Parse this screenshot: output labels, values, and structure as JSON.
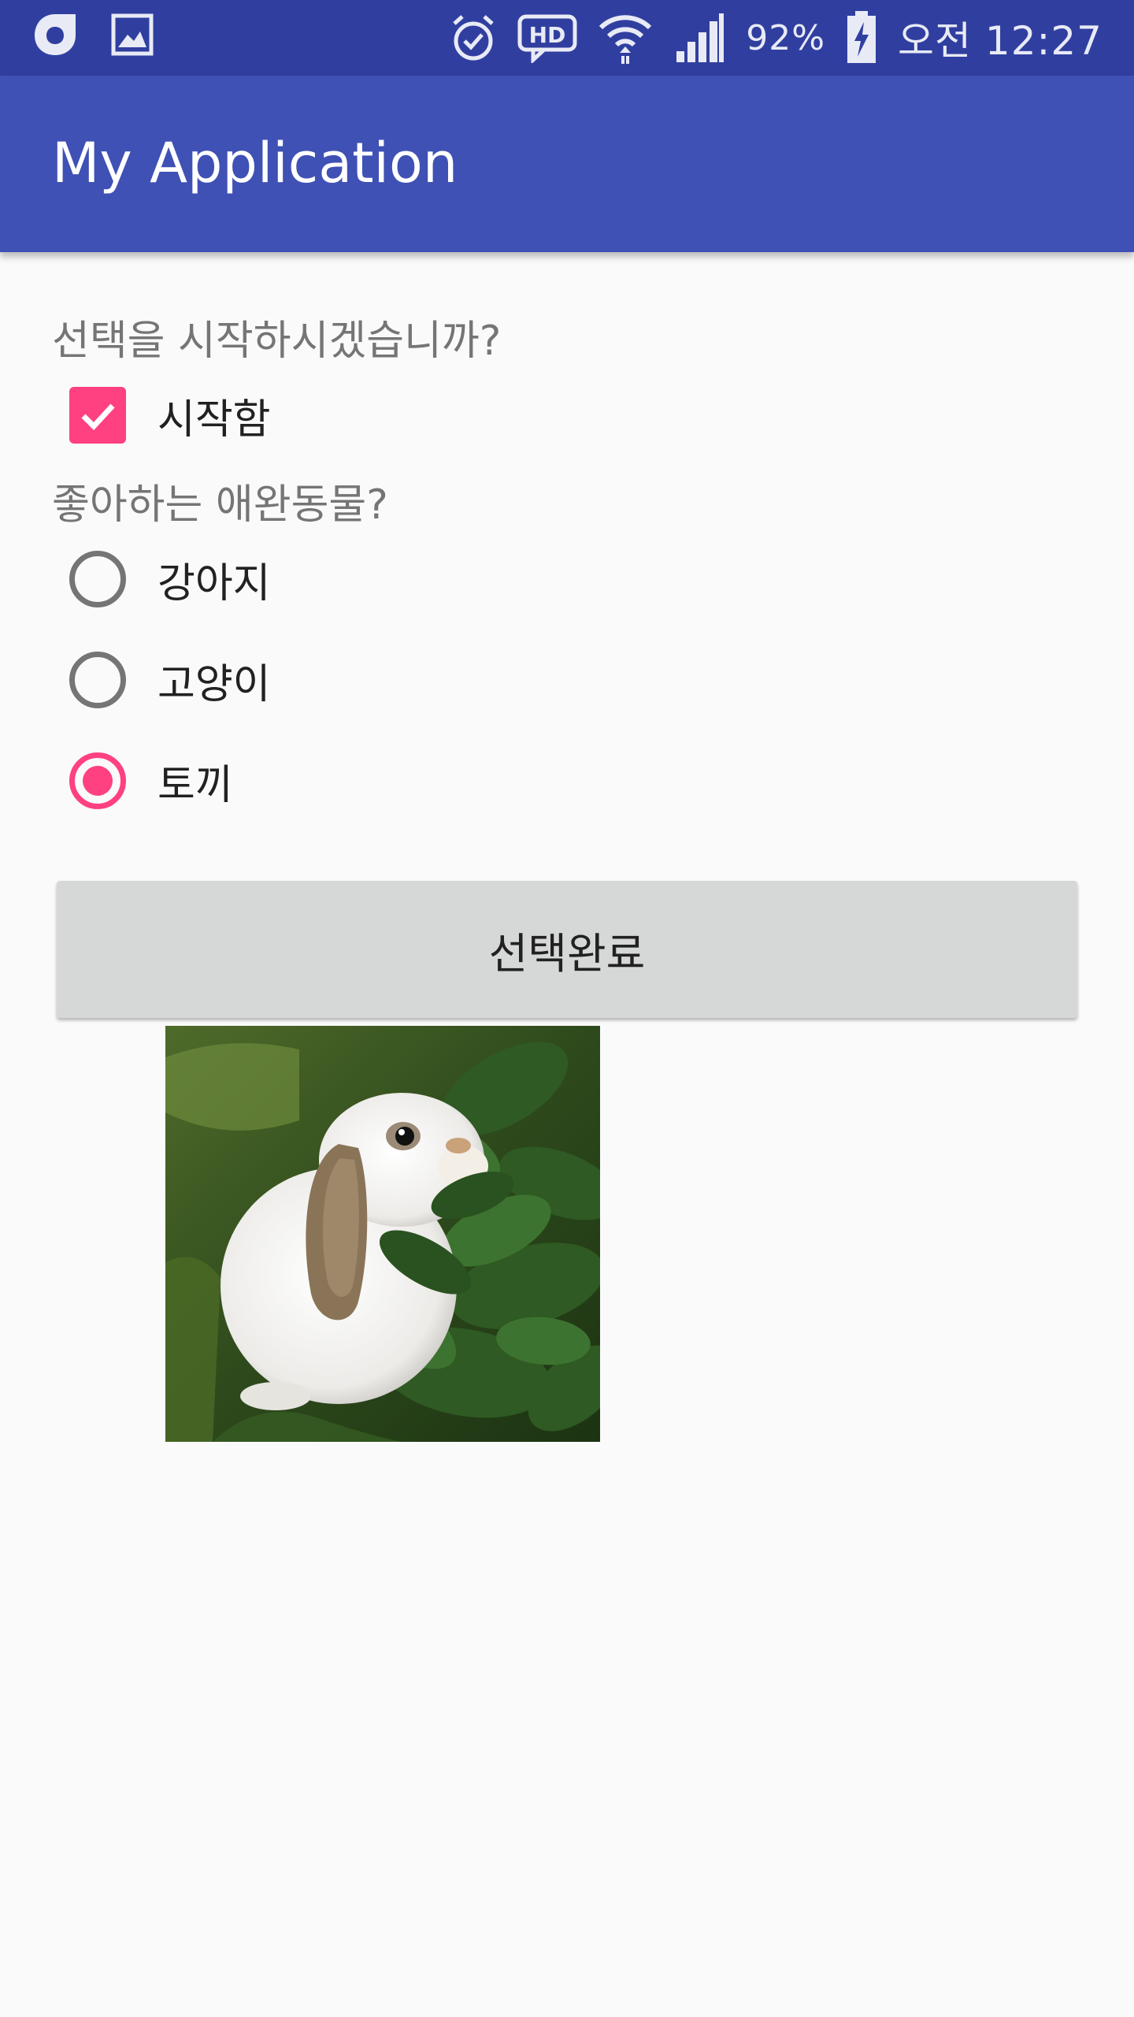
{
  "status_bar": {
    "time": "오전 12:27",
    "battery_percent": "92%",
    "network_badge": "HD",
    "icons": [
      "carrier-icon",
      "gallery-icon",
      "alarm-icon",
      "hd-voice-icon",
      "wifi-icon",
      "signal-icon",
      "battery-charging-icon"
    ]
  },
  "app_bar": {
    "title": "My Application"
  },
  "form": {
    "start_question": "선택을 시작하시겠습니까?",
    "start_checkbox": {
      "label": "시작함",
      "checked": true
    },
    "pet_question": "좋아하는 애완동물?",
    "pet_options": [
      {
        "label": "강아지",
        "selected": false
      },
      {
        "label": "고양이",
        "selected": false
      },
      {
        "label": "토끼",
        "selected": true
      }
    ],
    "done_button_label": "선택완료"
  },
  "image": {
    "subject": "white lop-eared rabbit eating leaves"
  },
  "colors": {
    "status_bar": "#303f9f",
    "app_bar": "#3f51b5",
    "accent": "#ff4081",
    "background": "#fafafa",
    "button": "#d6d7d7"
  }
}
